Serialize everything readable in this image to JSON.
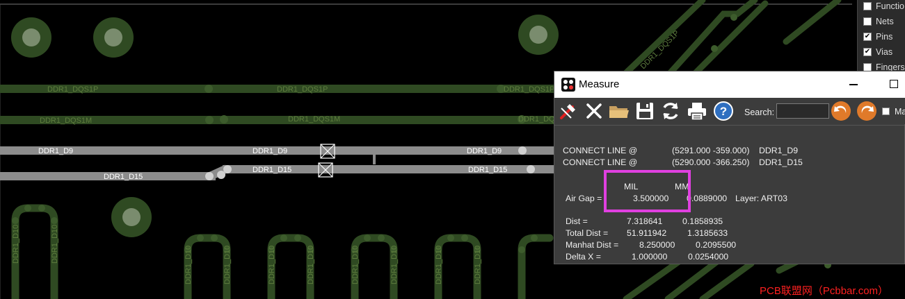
{
  "canvas": {
    "board_color": "#000000",
    "trace_green": "#2f4a22",
    "trace_gray": "#8c8c8c",
    "label_green": "#5e7d3e",
    "labels": {
      "dqs1p_a": "DDR1_DQS1P",
      "dqs1p_b": "DDR1_DQS1P",
      "dqs1p_c": "DDR1_DQS1P",
      "dqs1m_a": "DDR1_DQS1M",
      "dqs1m_b": "DDR1_DQS1M",
      "dqs1m_c": "DDR1_DQ",
      "d9_a": "DDR1_D9",
      "d9_b": "DDR1_D9",
      "d9_c": "DDR1_D9",
      "d15_a": "DDR1_D15",
      "d15_b": "DDR1_D15",
      "d15_c": "DDR1_D15",
      "dqs1p_diag": "DDR1_DQS1P",
      "d10": "DDR1_D10"
    }
  },
  "visibility_panel": {
    "items": [
      {
        "label": "Functio",
        "checked": false
      },
      {
        "label": "Nets",
        "checked": false
      },
      {
        "label": "Pins",
        "checked": true
      },
      {
        "label": "Vias",
        "checked": true
      },
      {
        "label": "Fingers",
        "checked": false
      }
    ]
  },
  "measure_window": {
    "title": "Measure",
    "toolbar": {
      "pick_icon": "measure-pick-icon",
      "clear_icon": "close-icon",
      "open_icon": "folder-icon",
      "save_icon": "save-icon",
      "refresh_icon": "refresh-icon",
      "print_icon": "print-icon",
      "help_icon": "help-icon",
      "help_glyph": "?",
      "search_label": "Search:",
      "search_value": "",
      "back_icon": "arrow-left-icon",
      "forward_icon": "arrow-right-icon",
      "match_label": "Ma"
    },
    "content": {
      "line1_label": "CONNECT LINE @",
      "line1_coord": "(5291.000 -359.000)",
      "line1_net": "DDR1_D9",
      "line2_label": "CONNECT LINE @",
      "line2_coord": "(5290.000 -366.250)",
      "line2_net": "DDR1_D15",
      "unit_mil": "MIL",
      "unit_mm": "MM",
      "air_gap_label": "Air Gap =",
      "air_gap_mil": "3.500000",
      "air_gap_mm": "0.0889000",
      "layer": "Layer: ART03",
      "dist_label": "Dist =",
      "dist_mil": "7.318641",
      "dist_mm": "0.1858935",
      "total_label": "Total Dist =",
      "total_mil": "51.911942",
      "total_mm": "1.3185633",
      "manhat_label": "Manhat Dist =",
      "manhat_mil": "8.250000",
      "manhat_mm": "0.2095500",
      "deltax_label": "Delta X =",
      "deltax_mil": "1.000000",
      "deltax_mm": "0.0254000"
    }
  },
  "watermark": "PCB联盟网（Pcbbar.com）",
  "highlight_color": "#e040e0"
}
